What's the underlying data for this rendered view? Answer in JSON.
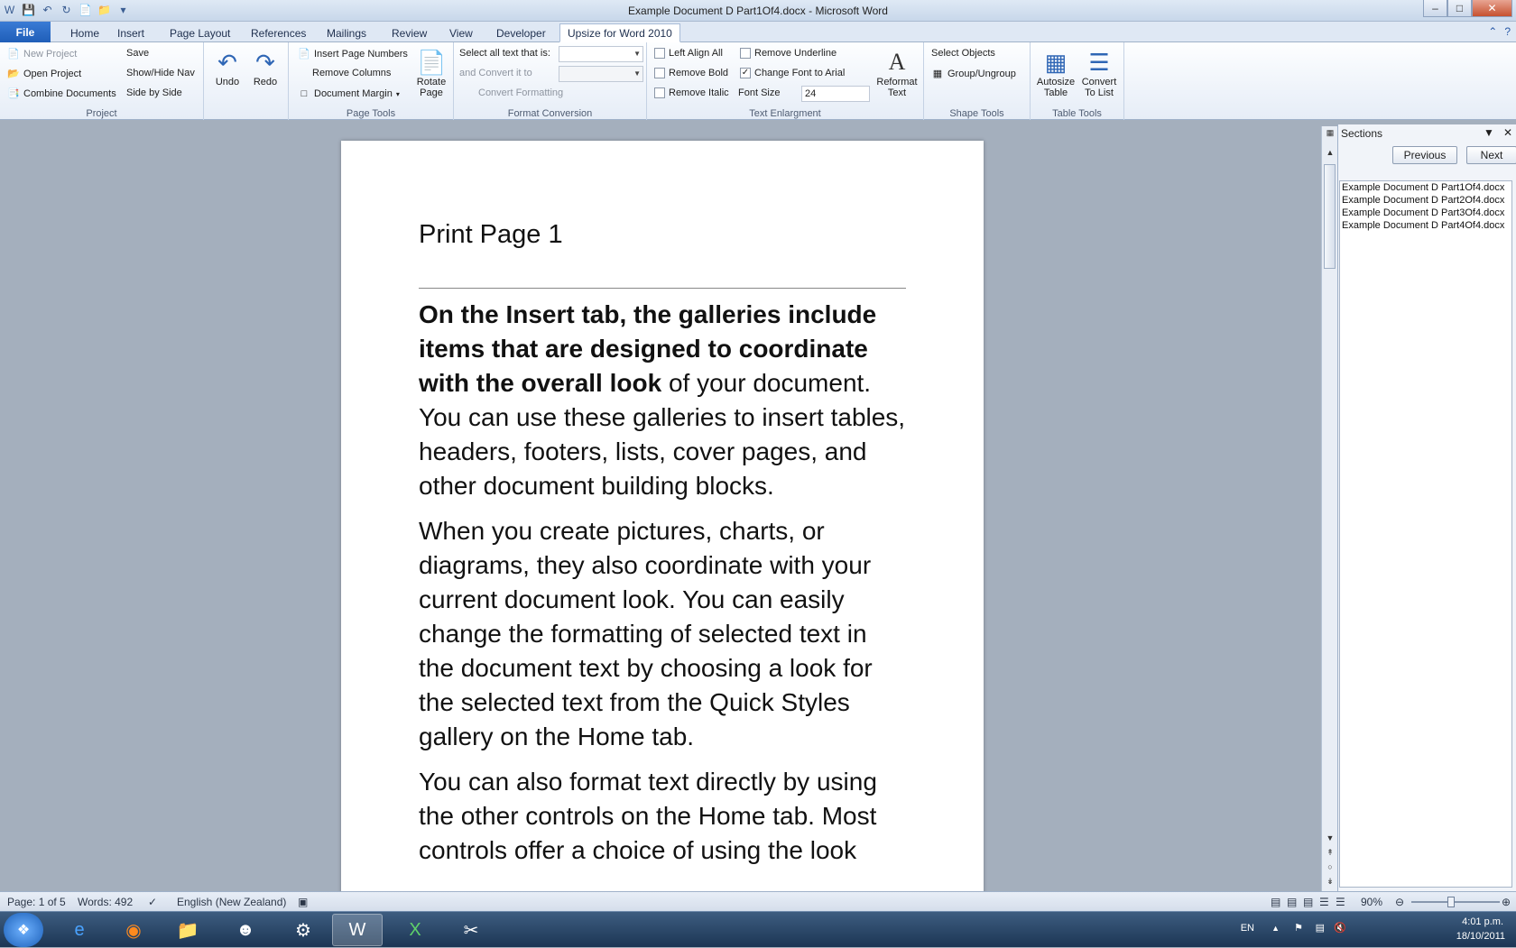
{
  "window": {
    "title": "Example Document D Part1Of4.docx - Microsoft Word"
  },
  "tabs": [
    "File",
    "Home",
    "Insert",
    "Page Layout",
    "References",
    "Mailings",
    "Review",
    "View",
    "Developer",
    "Upsize for Word 2010"
  ],
  "ribbon": {
    "project": {
      "label": "Project",
      "new_project": "New Project",
      "open_project": "Open Project",
      "combine_documents": "Combine Documents",
      "save": "Save",
      "show_hide_nav": "Show/Hide Nav",
      "side_by_side": "Side by Side"
    },
    "undo": "Undo",
    "redo": "Redo",
    "page_tools": {
      "label": "Page Tools",
      "insert_page_numbers": "Insert Page Numbers",
      "remove_columns": "Remove Columns",
      "document_margin": "Document Margin",
      "rotate_page": "Rotate Page"
    },
    "format_conversion": {
      "label": "Format Conversion",
      "select_all_text": "Select all text that is:",
      "convert_it_to": "and Convert it to",
      "convert_formatting": "Convert Formatting"
    },
    "text_enlargment": {
      "label": "Text Enlargment",
      "left_align_all": "Left Align All",
      "remove_bold": "Remove Bold",
      "remove_italic": "Remove Italic",
      "remove_underline": "Remove Underline",
      "change_font_arial": "Change Font to Arial",
      "font_size_label": "Font Size",
      "font_size_value": "24",
      "reformat_text": "Reformat Text"
    },
    "shape_tools": {
      "label": "Shape Tools",
      "select_objects": "Select Objects",
      "group_ungroup": "Group/Ungroup"
    },
    "table_tools": {
      "label": "Table Tools",
      "autosize_table": "Autosize Table",
      "convert_to_list": "Convert To List"
    }
  },
  "document": {
    "title": "Print Page 1",
    "p1_bold": "On the Insert tab, the galleries include items that are designed to coordinate with the overall look",
    "p1_rest": " of your document. You can use these galleries to insert tables, headers, footers, lists, cover pages, and other document building blocks.",
    "p2": "When you create pictures, charts, or diagrams, they also coordinate with your current document look. You can easily change the formatting of selected text in the document text by choosing a look for the selected text from the Quick Styles gallery on the Home tab.",
    "p3": "You can also format text directly by using the other controls on the Home tab. Most controls offer a choice of using the look"
  },
  "sections_pane": {
    "title": "Sections",
    "previous": "Previous",
    "next": "Next",
    "items": [
      "Example Document D Part1Of4.docx",
      "Example Document D Part2Of4.docx",
      "Example Document D Part3Of4.docx",
      "Example Document D Part4Of4.docx"
    ]
  },
  "status": {
    "page": "Page: 1 of 5",
    "words": "Words: 492",
    "language": "English (New Zealand)",
    "zoom": "90%"
  },
  "taskbar": {
    "lang": "EN",
    "time": "4:01 p.m.",
    "date": "18/10/2011"
  }
}
